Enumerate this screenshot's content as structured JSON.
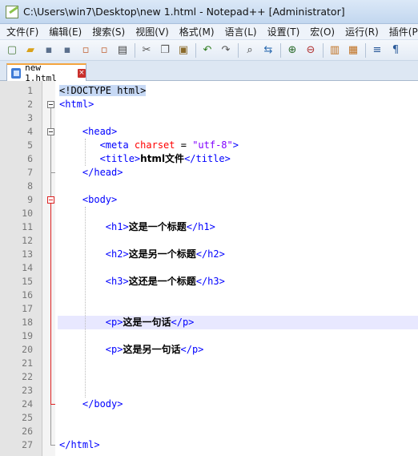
{
  "window": {
    "title": "C:\\Users\\win7\\Desktop\\new 1.html - Notepad++ [Administrator]"
  },
  "menu": [
    "文件(F)",
    "编辑(E)",
    "搜索(S)",
    "视图(V)",
    "格式(M)",
    "语言(L)",
    "设置(T)",
    "宏(O)",
    "运行(R)",
    "插件(P)"
  ],
  "toolbar": {
    "buttons": [
      {
        "name": "new-file-icon",
        "glyph": "▢",
        "color": "#4a7a3a"
      },
      {
        "name": "open-file-icon",
        "glyph": "▰",
        "color": "#d9a21b"
      },
      {
        "name": "save-icon",
        "glyph": "▪",
        "color": "#5a6f8c"
      },
      {
        "name": "save-all-icon",
        "glyph": "▪",
        "color": "#5a6f8c"
      },
      {
        "name": "close-icon",
        "glyph": "▫",
        "color": "#c06030"
      },
      {
        "name": "close-all-icon",
        "glyph": "▫",
        "color": "#c06030"
      },
      {
        "name": "print-icon",
        "glyph": "▤",
        "color": "#444"
      },
      {
        "sep": true
      },
      {
        "name": "cut-icon",
        "glyph": "✂",
        "color": "#555"
      },
      {
        "name": "copy-icon",
        "glyph": "❐",
        "color": "#555"
      },
      {
        "name": "paste-icon",
        "glyph": "▣",
        "color": "#8a6a2a"
      },
      {
        "sep": true
      },
      {
        "name": "undo-icon",
        "glyph": "↶",
        "color": "#2f7d1f"
      },
      {
        "name": "redo-icon",
        "glyph": "↷",
        "color": "#555"
      },
      {
        "sep": true
      },
      {
        "name": "find-icon",
        "glyph": "⌕",
        "color": "#333"
      },
      {
        "name": "replace-icon",
        "glyph": "⇆",
        "color": "#2a6ab0"
      },
      {
        "sep": true
      },
      {
        "name": "zoom-in-icon",
        "glyph": "⊕",
        "color": "#2a6a2a"
      },
      {
        "name": "zoom-out-icon",
        "glyph": "⊖",
        "color": "#b03030"
      },
      {
        "sep": true
      },
      {
        "name": "sync-vertical-icon",
        "glyph": "▥",
        "color": "#c07020"
      },
      {
        "name": "sync-horizontal-icon",
        "glyph": "▦",
        "color": "#c07020"
      },
      {
        "sep": true
      },
      {
        "name": "word-wrap-icon",
        "glyph": "≡",
        "color": "#2a5a9a"
      },
      {
        "name": "show-all-chars-icon",
        "glyph": "¶",
        "color": "#2a5a9a"
      }
    ]
  },
  "tab": {
    "label": "new 1.html",
    "close": "×"
  },
  "editor": {
    "current_line": 18,
    "lines": [
      {
        "n": "1",
        "tokens": [
          {
            "c": "doctype",
            "t": "<!DOCTYPE html>"
          }
        ]
      },
      {
        "n": "2",
        "tokens": [
          {
            "c": "tag",
            "t": "<html>"
          }
        ]
      },
      {
        "n": "3",
        "tokens": []
      },
      {
        "n": "4",
        "tokens": [
          {
            "c": "tag",
            "t": "    <head>"
          }
        ]
      },
      {
        "n": "5",
        "tokens": [
          {
            "c": "tag",
            "t": "       <meta "
          },
          {
            "c": "attr",
            "t": "charset"
          },
          {
            "c": "plain",
            "t": " = "
          },
          {
            "c": "val",
            "t": "\"utf-8\""
          },
          {
            "c": "tag",
            "t": ">"
          }
        ]
      },
      {
        "n": "6",
        "tokens": [
          {
            "c": "tag",
            "t": "       <title>"
          },
          {
            "c": "text",
            "t": "html文件"
          },
          {
            "c": "tag",
            "t": "</title>"
          }
        ]
      },
      {
        "n": "7",
        "tokens": [
          {
            "c": "tag",
            "t": "    </head>"
          }
        ]
      },
      {
        "n": "8",
        "tokens": []
      },
      {
        "n": "9",
        "tokens": [
          {
            "c": "tag",
            "t": "    <body>"
          }
        ]
      },
      {
        "n": "10",
        "tokens": []
      },
      {
        "n": "11",
        "tokens": [
          {
            "c": "tag",
            "t": "        <h1>"
          },
          {
            "c": "text",
            "t": "这是一个标题"
          },
          {
            "c": "tag",
            "t": "</h1>"
          }
        ]
      },
      {
        "n": "12",
        "tokens": []
      },
      {
        "n": "13",
        "tokens": [
          {
            "c": "tag",
            "t": "        <h2>"
          },
          {
            "c": "text",
            "t": "这是另一个标题"
          },
          {
            "c": "tag",
            "t": "</h2>"
          }
        ]
      },
      {
        "n": "14",
        "tokens": []
      },
      {
        "n": "15",
        "tokens": [
          {
            "c": "tag",
            "t": "        <h3>"
          },
          {
            "c": "text",
            "t": "这还是一个标题"
          },
          {
            "c": "tag",
            "t": "</h3>"
          }
        ]
      },
      {
        "n": "16",
        "tokens": []
      },
      {
        "n": "17",
        "tokens": []
      },
      {
        "n": "18",
        "tokens": [
          {
            "c": "tag",
            "t": "        <p>"
          },
          {
            "c": "text",
            "t": "这是一句话"
          },
          {
            "c": "tag",
            "t": "</p>"
          }
        ]
      },
      {
        "n": "19",
        "tokens": []
      },
      {
        "n": "20",
        "tokens": [
          {
            "c": "tag",
            "t": "        <p>"
          },
          {
            "c": "text",
            "t": "这是另一句话"
          },
          {
            "c": "tag",
            "t": "</p>"
          }
        ]
      },
      {
        "n": "21",
        "tokens": []
      },
      {
        "n": "22",
        "tokens": []
      },
      {
        "n": "23",
        "tokens": []
      },
      {
        "n": "24",
        "tokens": [
          {
            "c": "tag",
            "t": "    </body>"
          }
        ]
      },
      {
        "n": "25",
        "tokens": []
      },
      {
        "n": "26",
        "tokens": []
      },
      {
        "n": "27",
        "tokens": [
          {
            "c": "tag",
            "t": "</html>"
          }
        ]
      }
    ]
  }
}
